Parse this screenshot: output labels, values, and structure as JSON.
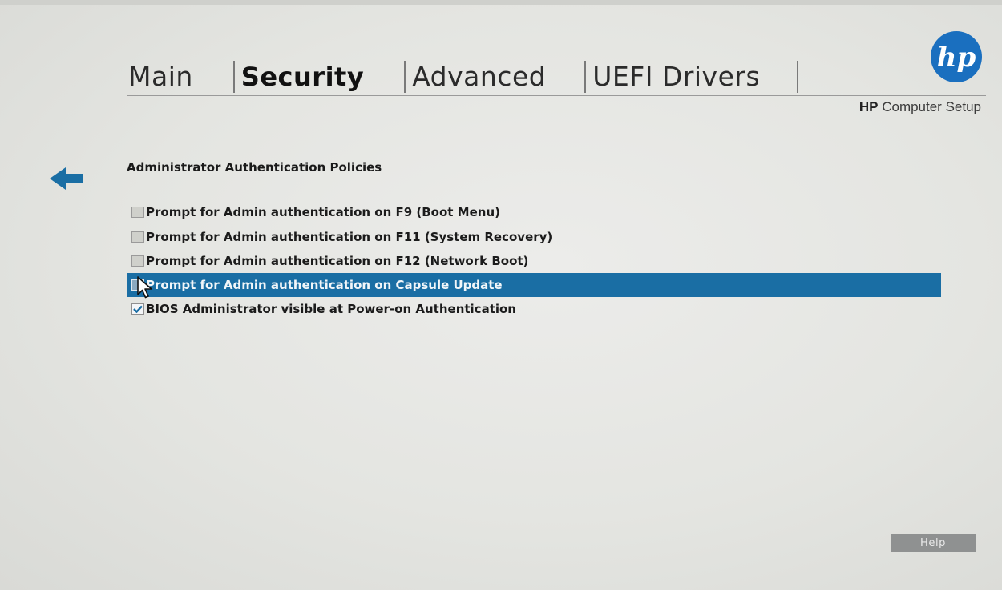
{
  "header": {
    "tabs": [
      {
        "label": "Main",
        "selected": false
      },
      {
        "label": "Security",
        "selected": true
      },
      {
        "label": "Advanced",
        "selected": false
      },
      {
        "label": "UEFI Drivers",
        "selected": false
      }
    ],
    "brand_bold": "HP",
    "brand_rest": " Computer Setup",
    "logo_text": "hp"
  },
  "page": {
    "title": "Administrator Authentication Policies"
  },
  "options": [
    {
      "label": "Prompt for Admin authentication on F9 (Boot Menu)",
      "checked": false,
      "selected": false
    },
    {
      "label": "Prompt for Admin authentication on F11 (System Recovery)",
      "checked": false,
      "selected": false
    },
    {
      "label": "Prompt for Admin authentication on F12 (Network Boot)",
      "checked": false,
      "selected": false
    },
    {
      "label": "Prompt for Admin authentication on Capsule Update",
      "checked": false,
      "selected": true
    },
    {
      "label": "BIOS Administrator visible at Power-on Authentication",
      "checked": true,
      "selected": false
    }
  ],
  "footer": {
    "help_label": "Help"
  },
  "colors": {
    "accent": "#1a6ea4",
    "logo": "#1a6fbf",
    "background": "#e6e7e2"
  },
  "icons": {
    "back": "arrow-left-icon",
    "check": "checkmark-icon",
    "cursor": "mouse-pointer-icon"
  }
}
